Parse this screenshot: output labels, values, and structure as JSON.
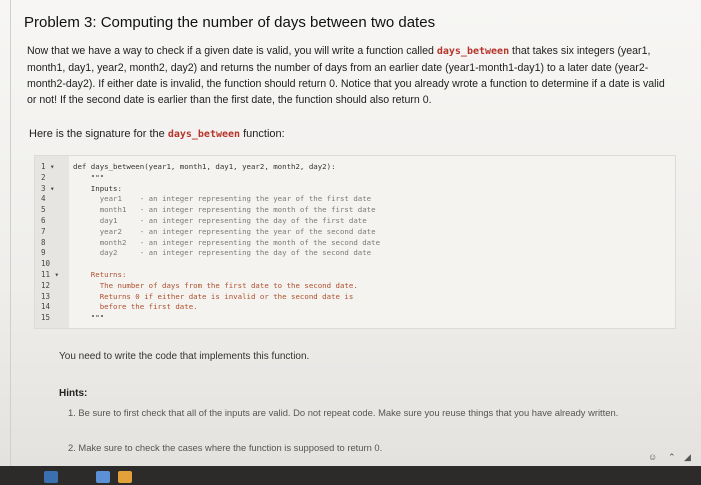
{
  "problem": {
    "title": "Problem 3: Computing the number of days between two dates",
    "intro_before_fn": "Now that we have a way to check if a given date is valid, you will write a function called",
    "fn_name": "days_between",
    "intro_after_fn": "that takes six integers (year1, month1, day1, year2, month2, day2) and returns the number of days from an earlier date (year1-month1-day1) to a later date (year2-month2-day2). If either date is invalid, the function should return 0. Notice that you already wrote a function to determine if a date is valid or not! If the second date is earlier than the first date, the function should also return 0.",
    "signature_prefix": "Here is the signature for the",
    "signature_suffix": "function:"
  },
  "code": {
    "line_numbers": [
      "1 ▾",
      "2",
      "3 ▾",
      "4",
      "5",
      "6",
      "7",
      "8",
      "9",
      "10",
      "11 ▾",
      "12",
      "13",
      "14",
      "15"
    ],
    "lines": [
      "def days_between(year1, month1, day1, year2, month2, day2):",
      "    \"\"\"",
      "    Inputs:",
      "      year1    - an integer representing the year of the first date",
      "      month1   - an integer representing the month of the first date",
      "      day1     - an integer representing the day of the first date",
      "      year2    - an integer representing the year of the second date",
      "      month2   - an integer representing the month of the second date",
      "      day2     - an integer representing the day of the second date",
      "",
      "    Returns:",
      "      The number of days from the first date to the second date.",
      "      Returns 0 if either date is invalid or the second date is",
      "      before the first date.",
      "    \"\"\""
    ]
  },
  "instructions": {
    "need": "You need to write the code that implements this function.",
    "hints_label": "Hints:",
    "hints": [
      "1. Be sure to first check that all of the inputs are valid. Do not repeat code. Make sure you reuse things that you have already written.",
      "2. Make sure to check the cases where the function is supposed to return 0."
    ]
  },
  "tray": {
    "people_icon": "people-icon",
    "chevron_icon": "chevron-up-icon",
    "wifi_icon": "wifi-icon"
  }
}
